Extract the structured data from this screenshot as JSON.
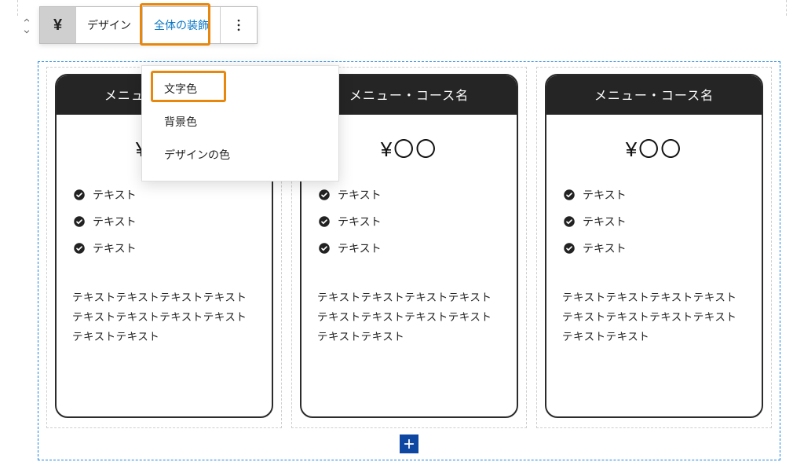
{
  "toolbar": {
    "yen_symbol": "¥",
    "design_label": "デザイン",
    "decor_label": "全体の装飾"
  },
  "dropdown": {
    "items": [
      "文字色",
      "背景色",
      "デザインの色"
    ]
  },
  "cards": [
    {
      "title": "メニュー・コース名",
      "price": "¥〇〇",
      "features": [
        "テキスト",
        "テキスト",
        "テキスト"
      ],
      "desc": "テキストテキストテキストテキストテキストテキストテキストテキストテキストテキスト"
    },
    {
      "title": "メニュー・コース名",
      "price": "¥〇〇",
      "features": [
        "テキスト",
        "テキスト",
        "テキスト"
      ],
      "desc": "テキストテキストテキストテキストテキストテキストテキストテキストテキストテキスト"
    },
    {
      "title": "メニュー・コース名",
      "price": "¥〇〇",
      "features": [
        "テキスト",
        "テキスト",
        "テキスト"
      ],
      "desc": "テキストテキストテキストテキストテキストテキストテキストテキストテキストテキスト"
    }
  ]
}
